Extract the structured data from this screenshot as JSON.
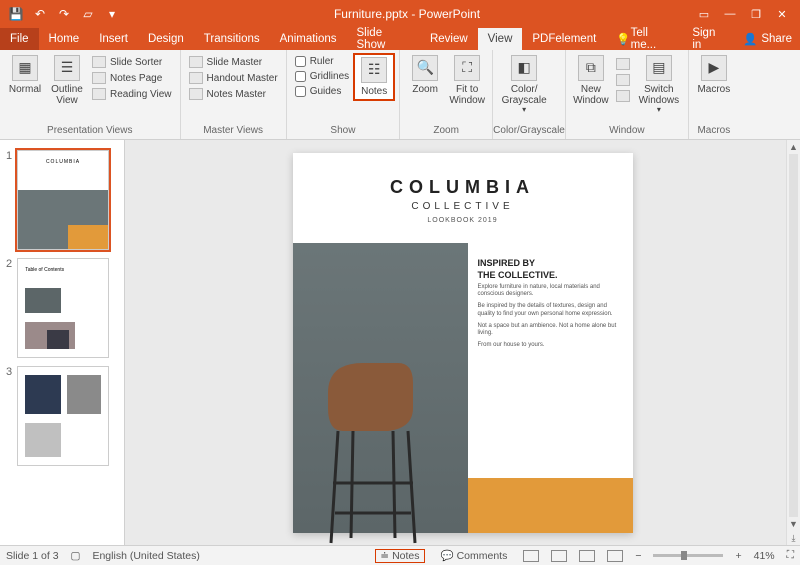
{
  "titlebar": {
    "title": "Furniture.pptx - PowerPoint"
  },
  "tabs": {
    "file": "File",
    "home": "Home",
    "insert": "Insert",
    "design": "Design",
    "transitions": "Transitions",
    "animations": "Animations",
    "slideshow": "Slide Show",
    "review": "Review",
    "view": "View",
    "pdfelement": "PDFelement",
    "tellme": "Tell me...",
    "signin": "Sign in",
    "share": "Share"
  },
  "ribbon": {
    "presentation_views": {
      "label": "Presentation Views",
      "normal": "Normal",
      "outline": "Outline View",
      "slide_sorter": "Slide Sorter",
      "notes_page": "Notes Page",
      "reading_view": "Reading View"
    },
    "master_views": {
      "label": "Master Views",
      "slide_master": "Slide Master",
      "handout_master": "Handout Master",
      "notes_master": "Notes Master"
    },
    "show": {
      "label": "Show",
      "ruler": "Ruler",
      "gridlines": "Gridlines",
      "guides": "Guides",
      "notes": "Notes"
    },
    "zoom": {
      "label": "Zoom",
      "zoom": "Zoom",
      "fit": "Fit to Window"
    },
    "color_gray": {
      "label": "Color/Grayscale",
      "btn": "Color/ Grayscale"
    },
    "window": {
      "label": "Window",
      "new": "New Window",
      "switch": "Switch Windows"
    },
    "macros": {
      "label": "Macros",
      "btn": "Macros"
    }
  },
  "thumbnails": {
    "n1": "1",
    "n2": "2",
    "n3": "3",
    "t1_title": "COLUMBIA",
    "t2_title": "Table of Contents"
  },
  "slide": {
    "title": "COLUMBIA",
    "subtitle": "COLLECTIVE",
    "small": "LOOKBOOK 2019",
    "h1": "INSPIRED BY",
    "h2": "THE COLLECTIVE.",
    "p1": "Explore furniture in nature, local materials and conscious designers.",
    "p2": "Be inspired by the details of textures, design and quality to find your own personal home expression.",
    "p3": "Not a space but an ambience. Not a home alone but living.",
    "p4": "From our house to yours."
  },
  "status": {
    "slide_info": "Slide 1 of 3",
    "language": "English (United States)",
    "notes": "Notes",
    "comments": "Comments",
    "zoom_pct": "41%"
  }
}
